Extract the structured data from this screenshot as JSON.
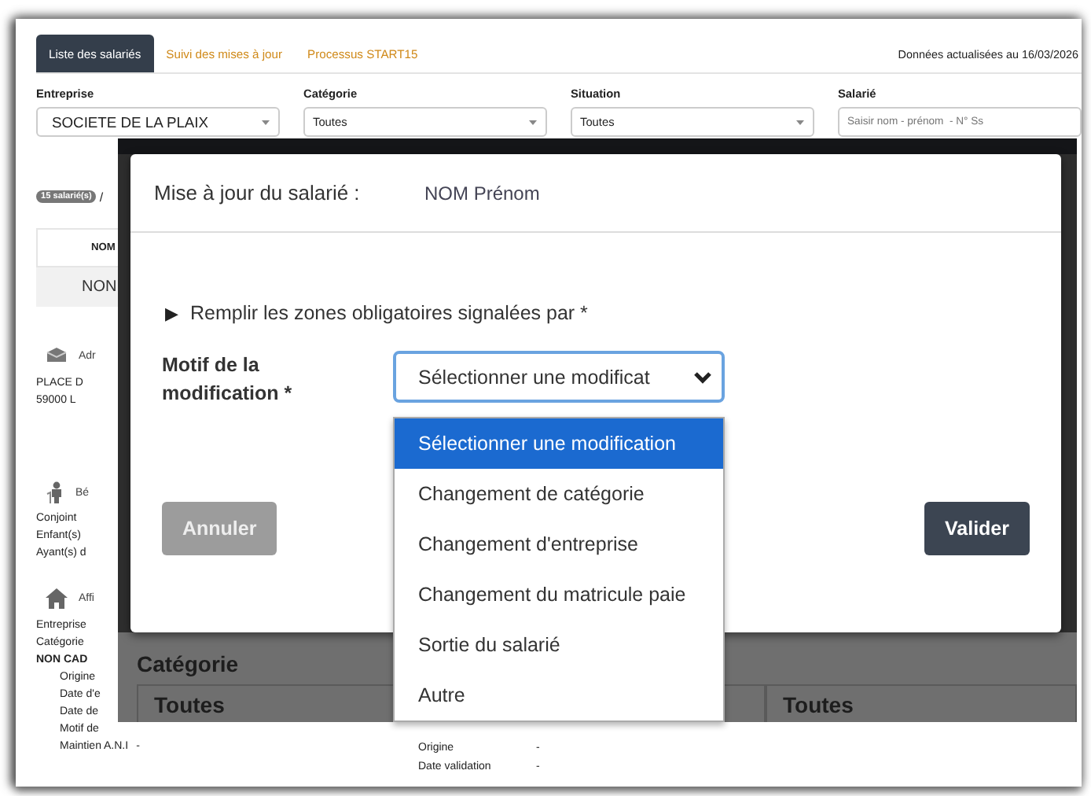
{
  "tabs": [
    {
      "label": "Liste des salariés",
      "selected": true
    },
    {
      "label": "Suivi des mises à jour",
      "selected": false
    },
    {
      "label": "Processus START15",
      "selected": false
    }
  ],
  "update_note": "Données actualisées au 16/03/2026",
  "filters": [
    {
      "kind": "select",
      "label": "Entreprise",
      "value": "SOCIETE DE LA PLAIX"
    },
    {
      "kind": "select",
      "label": "Catégorie",
      "value": "Toutes"
    },
    {
      "kind": "select",
      "label": "Situation",
      "value": "Toutes"
    },
    {
      "kind": "search",
      "label": "Salarié",
      "placeholder": "Saisir nom - prénom  - N° Ss"
    }
  ],
  "summary": {
    "badge": "15 salarié(s)",
    "separator": "/"
  },
  "table": {
    "column_1": "NOM",
    "cell": "NON"
  },
  "sections": [
    {
      "kind": "address",
      "title": "Adr",
      "lines": [
        {
          "kind": "plain",
          "text": "PLACE D"
        },
        {
          "kind": "plain",
          "text": "59000 L"
        }
      ]
    },
    {
      "kind": "person",
      "title": "Bé",
      "lines": [
        {
          "kind": "plain",
          "text": "Conjoint"
        },
        {
          "kind": "plain",
          "text": "Enfant(s)"
        },
        {
          "kind": "plain",
          "text": "Ayant(s) d"
        }
      ]
    },
    {
      "kind": "house",
      "title": "Affi",
      "lines": [
        {
          "kind": "plain",
          "text": "Entreprise"
        },
        {
          "kind": "plain",
          "text": "Catégorie"
        },
        {
          "kind": "heading",
          "text": "NON CAD"
        },
        {
          "kind": "sub",
          "text": "Origine"
        },
        {
          "kind": "sub",
          "text": "Date d'e"
        },
        {
          "kind": "sub",
          "text": "Date de"
        },
        {
          "kind": "sub",
          "text": "Motif de"
        },
        {
          "kind": "field",
          "text": "Maintien A.N.I",
          "value": "-"
        }
      ]
    }
  ],
  "details": [
    {
      "label": "Origine",
      "value": "-"
    },
    {
      "label": "Date validation",
      "value": "-"
    }
  ],
  "dimmed_form": {
    "label": "Catégorie",
    "selects": [
      "Toutes",
      "Toutes"
    ]
  },
  "modal": {
    "title": "Mise à jour du salarié :",
    "employee": "NOM Prénom",
    "hint_marker": "▶",
    "hint": "Remplir les zones obligatoires signalées par  *",
    "field_label": "Motif de la modification *",
    "select": {
      "value": "Sélectionner une modificat",
      "expanded": true
    },
    "options": [
      {
        "label": "Sélectionner une modification",
        "selected": true
      },
      {
        "label": "Changement de catégorie",
        "selected": false
      },
      {
        "label": "Changement d'entreprise",
        "selected": false
      },
      {
        "label": "Changement du matricule paie",
        "selected": false
      },
      {
        "label": "Sortie du salarié",
        "selected": false
      },
      {
        "label": "Autre",
        "selected": false
      }
    ],
    "buttons": [
      {
        "label": "Annuler",
        "disabled": true
      },
      {
        "label": "Valider",
        "disabled": false
      }
    ]
  }
}
